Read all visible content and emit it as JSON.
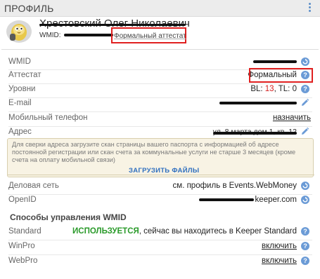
{
  "header": {
    "title": "ПРОФИЛЬ"
  },
  "profile": {
    "name": "Хрестовский Олег Николаевич",
    "wmid_label": "WMID:",
    "attestat_badge": "Формальный аттестат"
  },
  "rows": {
    "wmid": {
      "label": "WMID"
    },
    "attestat": {
      "label": "Аттестат",
      "value": "Формальный"
    },
    "levels": {
      "label": "Уровни",
      "bl_label": "BL:",
      "bl_value": "13",
      "tl_label": ", TL:",
      "tl_value": "0"
    },
    "email": {
      "label": "E-mail"
    },
    "phone": {
      "label": "Мобильный телефон",
      "action": "назначить"
    },
    "address": {
      "label": "Адрес",
      "value": "ул. 8 марта дом 1, кв. 12"
    }
  },
  "notice": {
    "text": "Для сверки адреса загрузите скан страницы вашего паспорта с информацией об адресе постоянной регистрации или скан счета за коммунальные услуги не старше 3 месяцев (кроме счета на оплату мобильной связи)",
    "button": "ЗАГРУЗИТЬ ФАЙЛЫ"
  },
  "business": {
    "label": "Деловая сеть",
    "value": "см. профиль в Events.WebMoney"
  },
  "openid": {
    "label": "OpenID",
    "value_suffix": "keeper.com"
  },
  "management": {
    "title": "Способы управления WMID",
    "standard": {
      "label": "Standard",
      "status": "ИСПОЛЬЗУЕТСЯ",
      "note": ", сейчас вы находитесь в Keeper Standard"
    },
    "winpro": {
      "label": "WinPro",
      "action": "включить"
    },
    "webpro": {
      "label": "WebPro",
      "action": "включить"
    }
  },
  "icons": [
    "more-vert-icon",
    "avatar-icon",
    "refresh-icon",
    "help-icon",
    "edit-pencil-icon"
  ],
  "colors": {
    "link": "#2f6fbf",
    "accent_blue": "#6b9bd6",
    "highlight_red": "#e02020",
    "in_use_green": "#2a9a2a",
    "notice_bg": "#f8f3e4"
  }
}
